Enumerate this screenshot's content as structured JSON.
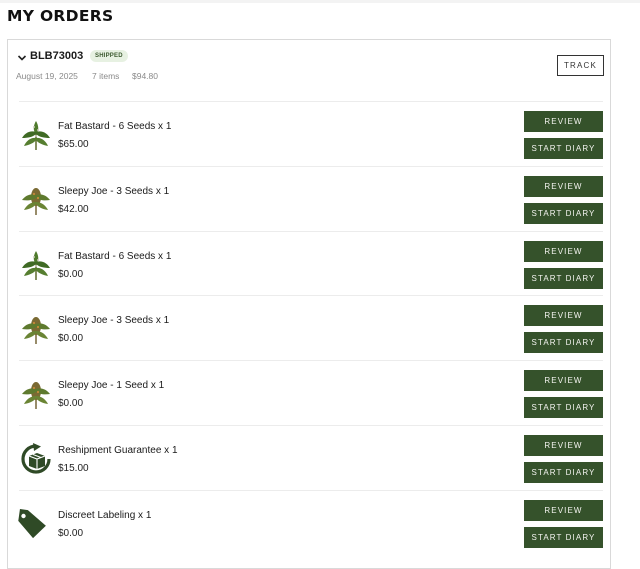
{
  "page": {
    "title": "MY ORDERS"
  },
  "order": {
    "id": "BLB73003",
    "status": "SHIPPED",
    "date": "August 19, 2025",
    "item_count": "7 items",
    "total": "$94.80",
    "track_label": "TRACK",
    "items": [
      {
        "name": "Fat Bastard - 6 Seeds x 1",
        "price": "$65.00",
        "icon": "cannabis-plant-icon"
      },
      {
        "name": "Sleepy Joe - 3 Seeds x 1",
        "price": "$42.00",
        "icon": "cannabis-bud-icon"
      },
      {
        "name": "Fat Bastard - 6 Seeds x 1",
        "price": "$0.00",
        "icon": "cannabis-plant-icon"
      },
      {
        "name": "Sleepy Joe - 3 Seeds x 1",
        "price": "$0.00",
        "icon": "cannabis-bud-icon"
      },
      {
        "name": "Sleepy Joe - 1 Seed x 1",
        "price": "$0.00",
        "icon": "cannabis-bud-icon"
      },
      {
        "name": "Reshipment Guarantee x 1",
        "price": "$15.00",
        "icon": "reshipment-box-icon"
      },
      {
        "name": "Discreet Labeling x 1",
        "price": "$0.00",
        "icon": "tag-icon"
      }
    ]
  },
  "actions": {
    "review_label": "REVIEW",
    "diary_label": "START DIARY"
  },
  "colors": {
    "accent": "#35522b",
    "badge_bg": "#e7f1e2",
    "badge_text": "#3c5a2f"
  }
}
